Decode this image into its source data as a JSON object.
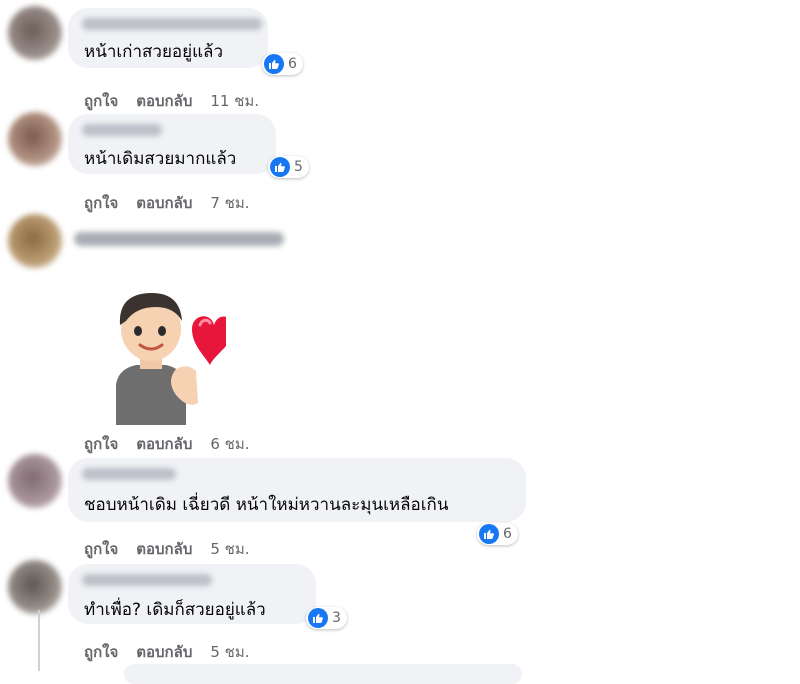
{
  "comments": [
    {
      "text": "หน้าเก่าสวยอยู่แล้ว",
      "like": "Like",
      "reply": "ตอบกลับ",
      "like_label": "ถูกใจ",
      "time": "11 ชม.",
      "reactions": "6"
    },
    {
      "text": "หน้าเดิมสวยมากแล้ว",
      "like_label": "ถูกใจ",
      "reply": "ตอบกลับ",
      "time": "7 ชม.",
      "reactions": "5"
    },
    {
      "text": "",
      "like_label": "ถูกใจ",
      "reply": "ตอบกลับ",
      "time": "6 ชม.",
      "sticker": "avatar-heart-sticker"
    },
    {
      "text": "ชอบหน้าเดิม เฉี่ยวดี หน้าใหม่หวานละมุนเหลือเกิน",
      "like_label": "ถูกใจ",
      "reply": "ตอบกลับ",
      "time": "5 ชม.",
      "reactions": "6"
    },
    {
      "text": "ทำเพื่อ? เดิมก็สวยอยู่แล้ว",
      "like_label": "ถูกใจ",
      "reply": "ตอบกลับ",
      "time": "5 ชม.",
      "reactions": "3"
    }
  ],
  "colors": {
    "like_blue": "#1877f2",
    "bubble": "#f0f2f5",
    "meta": "#65676b"
  },
  "icons": {
    "reaction": "thumbs-up-icon"
  }
}
